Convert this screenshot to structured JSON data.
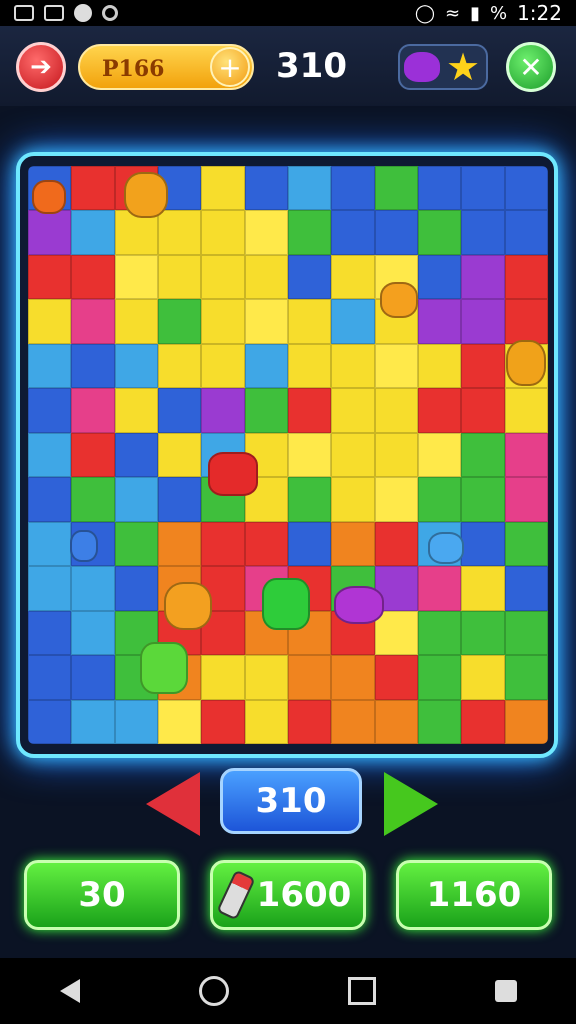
{
  "status_bar": {
    "time": "1:22",
    "battery_label": "%"
  },
  "top_bar": {
    "player_name": "P166",
    "plus_label": "+",
    "score": "310",
    "back_icon": "back-arrow-icon",
    "confirm_icon": "check-icon"
  },
  "board": {
    "rows": 13,
    "cols": 12,
    "palette": [
      "#3fbf3c",
      "#f7dd2c",
      "#e8312f",
      "#2f62d8",
      "#f0841f",
      "#9a3bd1",
      "#3fa7e6",
      "#e63f8a",
      "#ffe94a",
      "#67d84a"
    ],
    "grid": [
      [
        3,
        2,
        2,
        3,
        1,
        3,
        6,
        3,
        0,
        3,
        3,
        3
      ],
      [
        5,
        6,
        1,
        1,
        1,
        8,
        0,
        3,
        3,
        0,
        3,
        3
      ],
      [
        2,
        2,
        8,
        1,
        1,
        1,
        3,
        1,
        8,
        3,
        5,
        2
      ],
      [
        1,
        7,
        1,
        0,
        1,
        8,
        1,
        6,
        1,
        5,
        5,
        2
      ],
      [
        6,
        3,
        6,
        1,
        1,
        6,
        1,
        1,
        8,
        1,
        2,
        1
      ],
      [
        3,
        7,
        1,
        3,
        5,
        0,
        2,
        1,
        1,
        2,
        2,
        1
      ],
      [
        6,
        2,
        3,
        1,
        6,
        1,
        8,
        1,
        1,
        8,
        0,
        7
      ],
      [
        3,
        0,
        6,
        3,
        0,
        1,
        0,
        1,
        8,
        0,
        0,
        7
      ],
      [
        6,
        3,
        0,
        4,
        2,
        2,
        3,
        4,
        2,
        6,
        3,
        0
      ],
      [
        6,
        6,
        3,
        4,
        2,
        7,
        2,
        0,
        5,
        7,
        1,
        3
      ],
      [
        3,
        6,
        0,
        2,
        2,
        4,
        4,
        2,
        8,
        0,
        0,
        0
      ],
      [
        3,
        3,
        0,
        4,
        1,
        1,
        4,
        4,
        2,
        0,
        1,
        0
      ],
      [
        3,
        6,
        6,
        8,
        2,
        1,
        2,
        4,
        4,
        0,
        2,
        4
      ]
    ]
  },
  "controls": {
    "level": "310",
    "prev_icon": "left-arrow-icon",
    "next_icon": "right-arrow-icon"
  },
  "bottom_buttons": [
    {
      "label": "30"
    },
    {
      "label": "1600",
      "icon": "eraser-icon"
    },
    {
      "label": "1160"
    }
  ]
}
